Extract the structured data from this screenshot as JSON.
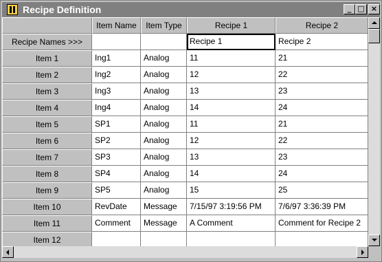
{
  "window": {
    "title": "Recipe Definition",
    "buttons": {
      "minimize": "_",
      "maximize": "□",
      "close": "×"
    }
  },
  "grid": {
    "columns": [
      "",
      "Item Name",
      "Item Type",
      "Recipe 1",
      "Recipe 2"
    ],
    "names_row": {
      "label": "Recipe Names >>>",
      "values": [
        "",
        "",
        "Recipe 1",
        "Recipe 2"
      ]
    },
    "rows": [
      {
        "label": "Item 1",
        "name": "Ing1",
        "type": "Analog",
        "r1": "11",
        "r2": "21"
      },
      {
        "label": "Item 2",
        "name": "Ing2",
        "type": "Analog",
        "r1": "12",
        "r2": "22"
      },
      {
        "label": "Item 3",
        "name": "Ing3",
        "type": "Analog",
        "r1": "13",
        "r2": "23"
      },
      {
        "label": "Item 4",
        "name": "Ing4",
        "type": "Analog",
        "r1": "14",
        "r2": "24"
      },
      {
        "label": "Item 5",
        "name": "SP1",
        "type": "Analog",
        "r1": "11",
        "r2": "21"
      },
      {
        "label": "Item 6",
        "name": "SP2",
        "type": "Analog",
        "r1": "12",
        "r2": "22"
      },
      {
        "label": "Item 7",
        "name": "SP3",
        "type": "Analog",
        "r1": "13",
        "r2": "23"
      },
      {
        "label": "Item 8",
        "name": "SP4",
        "type": "Analog",
        "r1": "14",
        "r2": "24"
      },
      {
        "label": "Item 9",
        "name": "SP5",
        "type": "Analog",
        "r1": "15",
        "r2": "25"
      },
      {
        "label": "Item 10",
        "name": "RevDate",
        "type": "Message",
        "r1": "7/15/97 3:19:56 PM",
        "r2": "7/6/97 3:36:39 PM"
      },
      {
        "label": "Item 11",
        "name": "Comment",
        "type": "Message",
        "r1": "A Comment",
        "r2": "Comment for Recipe 2"
      },
      {
        "label": "Item 12",
        "name": "",
        "type": "",
        "r1": "",
        "r2": ""
      }
    ]
  },
  "colors": {
    "titlebar": "#808080",
    "face": "#c0c0c0",
    "grid_line": "#808080"
  }
}
